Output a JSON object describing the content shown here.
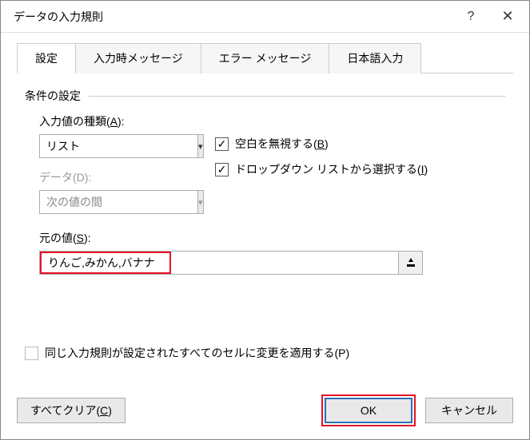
{
  "title": "データの入力規則",
  "tabs": [
    "設定",
    "入力時メッセージ",
    "エラー メッセージ",
    "日本語入力"
  ],
  "fieldset_label": "条件の設定",
  "allow_label_pre": "入力値の種類(",
  "allow_label_key": "A",
  "allow_label_post": "):",
  "allow_value": "リスト",
  "data_label": "データ(D):",
  "data_value": "次の値の間",
  "ignore_blank_pre": "空白を無視する(",
  "ignore_blank_key": "B",
  "ignore_blank_post": ")",
  "dropdown_pre": "ドロップダウン リストから選択する(",
  "dropdown_key": "I",
  "dropdown_post": ")",
  "source_label_pre": "元の値(",
  "source_label_key": "S",
  "source_label_post": "):",
  "source_value": "りんご,みかん,バナナ",
  "apply_label": "同じ入力規則が設定されたすべてのセルに変更を適用する(P)",
  "clear_pre": "すべてクリア(",
  "clear_key": "C",
  "clear_post": ")",
  "ok_label": "OK",
  "cancel_label": "キャンセル"
}
